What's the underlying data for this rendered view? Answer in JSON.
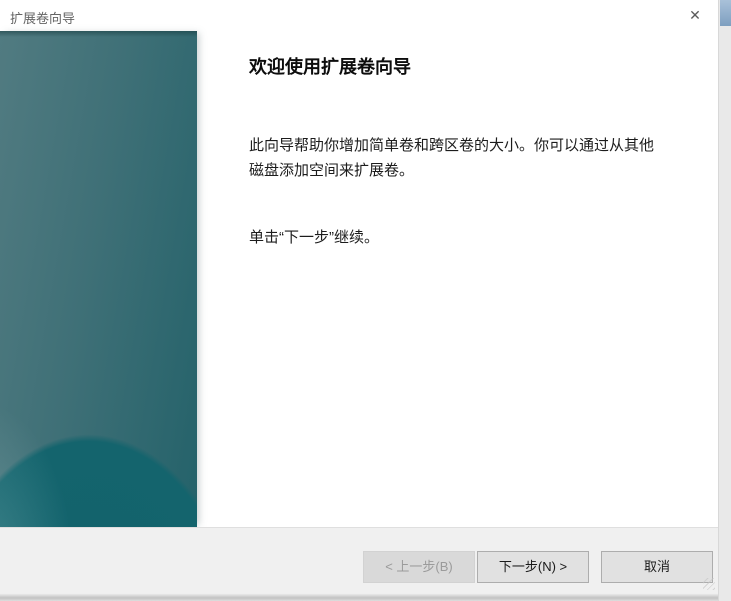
{
  "window": {
    "title": "扩展卷向导",
    "close_glyph": "✕"
  },
  "content": {
    "heading": "欢迎使用扩展卷向导",
    "paragraph1": "此向导帮助你增加简单卷和跨区卷的大小。你可以通过从其他磁盘添加空间来扩展卷。",
    "paragraph2": "单击“下一步”继续。"
  },
  "footer": {
    "back_label": "< 上一步(B)",
    "back_enabled": false,
    "next_label": "下一步(N) >",
    "cancel_label": "取消"
  },
  "colors": {
    "sidebar_teal_light": "#4f7a80",
    "sidebar_teal_dark": "#14646d",
    "titlebar_text": "#646464",
    "footer_bg": "#f0f0f0",
    "button_bg": "#e1e1e1",
    "button_border": "#adadad",
    "disabled_button_bg": "#d9d9d9",
    "disabled_button_text": "#9b9b9b",
    "background_accent_blue": "#85a3c2"
  }
}
